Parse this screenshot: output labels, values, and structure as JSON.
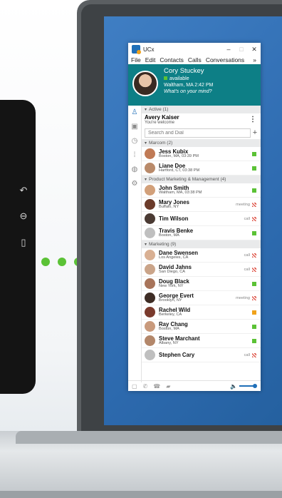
{
  "colors": {
    "accent": "#0d7f86",
    "available": "#5bc236",
    "busy": "#e05a4e",
    "away": "#f0a21b",
    "brand": "#1f6fb8"
  },
  "window": {
    "title": "UCx",
    "minimize": "–",
    "maximize": "□",
    "close": "✕"
  },
  "menu": {
    "items": [
      "File",
      "Edit",
      "Contacts",
      "Calls",
      "Conversations"
    ],
    "more": "»"
  },
  "profile": {
    "name": "Cory Stuckey",
    "status": "available",
    "location": "Waltham, MA 2:42 PM",
    "mood": "What's on your mind?"
  },
  "active": {
    "header": "Active (1)",
    "name": "Avery Kaiser",
    "sub": "You're welcome"
  },
  "search": {
    "placeholder": "Search and Dial",
    "add": "+"
  },
  "groups": [
    {
      "header": "Marcom (2)",
      "contacts": [
        {
          "name": "Jess Kubix",
          "loc": "Boston, MA, 03:39 PM",
          "status": "available",
          "label": "",
          "avatar": "#c07a55"
        },
        {
          "name": "Liane Doe",
          "loc": "Hartford, CT, 03:38 PM",
          "status": "available",
          "label": "",
          "avatar": "#b98a6a"
        }
      ]
    },
    {
      "header": "Product Marketing & Management (4)",
      "contacts": [
        {
          "name": "John Smith",
          "loc": "Waltham, MA, 03:38 PM",
          "status": "available",
          "label": "",
          "avatar": "#d2a07a"
        },
        {
          "name": "Mary Jones",
          "loc": "Buffalo, NY",
          "status": "busy",
          "label": "meeting",
          "avatar": "#6b3b2a"
        },
        {
          "name": "Tim Wilson",
          "loc": "",
          "status": "busy",
          "label": "call",
          "avatar": "#4a3a33"
        },
        {
          "name": "Travis Benke",
          "loc": "Boston, MA",
          "status": "available",
          "label": "",
          "avatar": "#bfbfbf"
        }
      ]
    },
    {
      "header": "Marketing (9)",
      "contacts": [
        {
          "name": "Dane Swensen",
          "loc": "Los Angeles, CA",
          "status": "busy",
          "label": "call",
          "avatar": "#d9b093"
        },
        {
          "name": "David Jahns",
          "loc": "San Diego, CA",
          "status": "busy",
          "label": "call",
          "avatar": "#caa489"
        },
        {
          "name": "Doug Black",
          "loc": "New York, NY",
          "status": "available",
          "label": "",
          "avatar": "#a8745a"
        },
        {
          "name": "George Evert",
          "loc": "Brooklyn, NY",
          "status": "busy",
          "label": "meeting",
          "avatar": "#3d2c24"
        },
        {
          "name": "Rachel Wild",
          "loc": "Berkeley, CA",
          "status": "away",
          "label": "",
          "avatar": "#7a3a2c"
        },
        {
          "name": "Ray Chang",
          "loc": "Boston, MA",
          "status": "available",
          "label": "",
          "avatar": "#c99a7c"
        },
        {
          "name": "Steve Marchant",
          "loc": "Albany, NY",
          "status": "available",
          "label": "",
          "avatar": "#b3876a"
        },
        {
          "name": "Stephen Cary",
          "loc": "",
          "status": "busy",
          "label": "call",
          "avatar": "#bfbfbf"
        }
      ]
    }
  ],
  "icons": {
    "sidebar": [
      "person-icon",
      "contact-card-icon",
      "clock-icon",
      "dialpad-icon",
      "globe-icon",
      "gear-icon"
    ],
    "footer": [
      "chat-icon",
      "phone-icon",
      "voicemail-icon",
      "video-icon",
      "volume-icon"
    ],
    "phone": [
      "back-arrow-icon",
      "login-icon",
      "document-icon"
    ]
  }
}
